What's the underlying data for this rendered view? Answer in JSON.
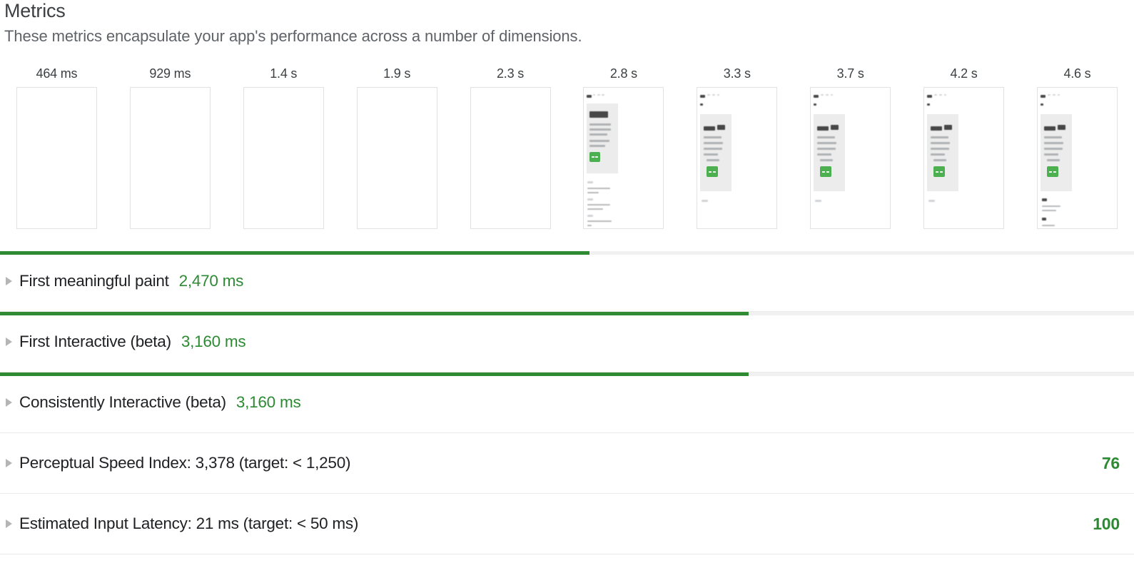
{
  "section": {
    "title": "Metrics",
    "description": "These metrics encapsulate your app's performance across a number of dimensions."
  },
  "filmstrip": {
    "frames": [
      {
        "time": "464 ms",
        "rendered": false
      },
      {
        "time": "929 ms",
        "rendered": false
      },
      {
        "time": "1.4 s",
        "rendered": false
      },
      {
        "time": "1.9 s",
        "rendered": false
      },
      {
        "time": "2.3 s",
        "rendered": false
      },
      {
        "time": "2.8 s",
        "rendered": true,
        "variant": "a"
      },
      {
        "time": "3.3 s",
        "rendered": true,
        "variant": "b"
      },
      {
        "time": "3.7 s",
        "rendered": true,
        "variant": "b"
      },
      {
        "time": "4.2 s",
        "rendered": true,
        "variant": "b"
      },
      {
        "time": "4.6 s",
        "rendered": true,
        "variant": "c"
      }
    ]
  },
  "metrics": [
    {
      "label": "First meaningful paint",
      "value": "2,470 ms",
      "score": "",
      "bar_percent": 52,
      "has_bar": true
    },
    {
      "label": "First Interactive (beta)",
      "value": "3,160 ms",
      "score": "",
      "bar_percent": 66,
      "has_bar": true
    },
    {
      "label": "Consistently Interactive (beta)",
      "value": "3,160 ms",
      "score": "",
      "bar_percent": 66,
      "has_bar": true
    },
    {
      "label": "Perceptual Speed Index: 3,378 (target: < 1,250)",
      "value": "",
      "score": "76",
      "bar_percent": 0,
      "has_bar": false
    },
    {
      "label": "Estimated Input Latency: 21 ms (target: < 50 ms)",
      "value": "",
      "score": "100",
      "bar_percent": 0,
      "has_bar": false
    }
  ],
  "colors": {
    "pass_green": "#2d8a33",
    "bar_green": "#2e8b33",
    "track_grey": "#f1f1f1",
    "text_primary": "#202124",
    "text_secondary": "#5f6368",
    "thumb_border": "#e2e2e2"
  },
  "icons": {
    "caret": "triangle-right-icon"
  }
}
